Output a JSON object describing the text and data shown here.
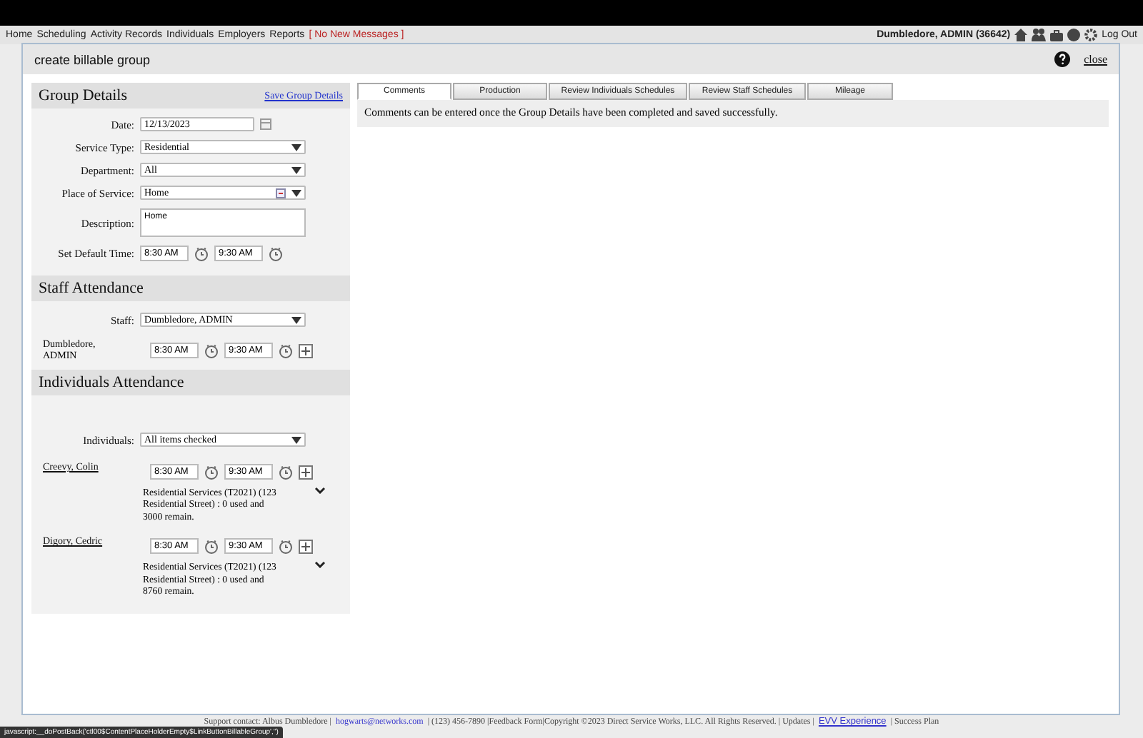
{
  "nav": {
    "links": [
      "Home",
      "Scheduling",
      "Activity Records",
      "Individuals",
      "Employers",
      "Reports"
    ],
    "messages": "[ No New Messages ]",
    "user": "Dumbledore, ADMIN  (36642)",
    "logout": "Log Out"
  },
  "modal": {
    "title": "create billable group",
    "close": "close"
  },
  "group_details": {
    "title": "Group Details",
    "save": "Save Group Details",
    "fields": [
      {
        "label": "Date:",
        "kind": "date",
        "value": "12/13/2023"
      },
      {
        "label": "Service Type:",
        "kind": "select",
        "value": "Residential"
      },
      {
        "label": "Department:",
        "kind": "select",
        "value": "All"
      },
      {
        "label": "Place of Service:",
        "kind": "lookup",
        "value": "Home"
      },
      {
        "label": "Description:",
        "kind": "textarea",
        "value": "Home"
      },
      {
        "label": "Set Default Time:",
        "kind": "times",
        "start": "8:30 AM",
        "end": "9:30 AM"
      }
    ]
  },
  "staff_attendance": {
    "title": "Staff Attendance",
    "label": "Staff:",
    "value": "Dumbledore, ADMIN",
    "rows": [
      {
        "name": "Dumbledore, ADMIN",
        "start": "8:30 AM",
        "end": "9:30 AM"
      }
    ]
  },
  "individuals_attendance": {
    "title": "Individuals Attendance",
    "label": "Individuals:",
    "value": "All items checked",
    "rows": [
      {
        "name": "Creevy, Colin",
        "start": "8:30 AM",
        "end": "9:30 AM",
        "note": "Residential Services (T2021) (123 Residential Street) : 0 used and 3000 remain."
      },
      {
        "name": "Digory, Cedric",
        "start": "8:30 AM",
        "end": "9:30 AM",
        "note": "Residential Services (T2021) (123 Residential Street) : 0 used and 8760 remain."
      }
    ]
  },
  "tabs": [
    {
      "label": "Comments",
      "selected": true
    },
    {
      "label": "Production",
      "selected": false
    },
    {
      "label": "Review Individuals Schedules",
      "selected": false
    },
    {
      "label": "Review Staff Schedules",
      "selected": false
    },
    {
      "label": "Mileage",
      "selected": false
    }
  ],
  "tab_message": "Comments can be entered once the Group Details have been completed and saved successfully.",
  "footer": {
    "text": "Support contact: Albus Dumbledore |",
    "email": "hogwarts@networks.com",
    "rest": "| (123) 456-7890 |Feedback Form|Copyright ©2023 Direct Service Works, LLC. All Rights Reserved. | Updates |",
    "evv": "EVV Experience",
    "success": "| Success Plan"
  },
  "status_bar": "javascript:__doPostBack('ctl00$ContentPlaceHolderEmpty$LinkButtonBillableGroup','')"
}
